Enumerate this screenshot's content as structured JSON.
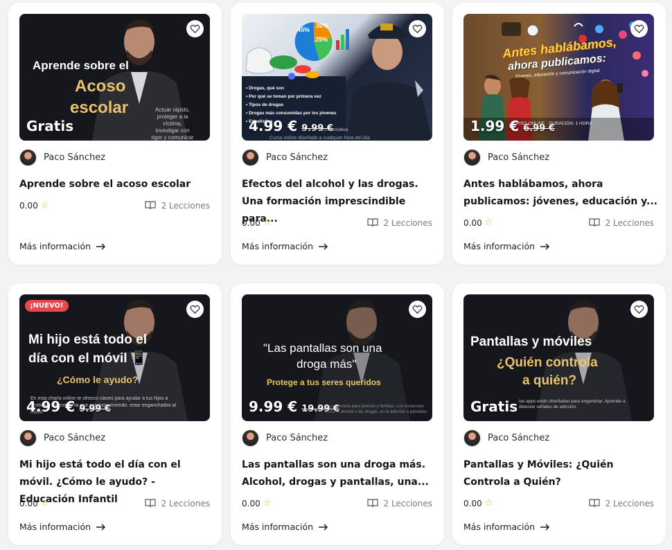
{
  "courses": [
    {
      "title": "Aprende sobre el acoso escolar",
      "author": "Paco Sánchez",
      "rating": "0.00",
      "lessons": "2 Lecciones",
      "more": "Más información",
      "price": "Gratis",
      "old_price": "",
      "badge": "",
      "thumb": {
        "line1": "Aprende sobre el",
        "line2": "Acoso",
        "line3": "escolar",
        "small": "Actuar rápido, proteger a la víctima, investigar con rigor y comunicar con"
      }
    },
    {
      "title": "Efectos del alcohol y las drogas. Una formación imprescindible para...",
      "author": "Paco Sánchez",
      "rating": "0.00",
      "lessons": "2 Lecciones",
      "more": "Más información",
      "price": "4.99 €",
      "old_price": "9.99 €",
      "badge": "",
      "thumb": {
        "pie1": "45%",
        "pie2": "30%",
        "pie3": "25%",
        "bullet1": "• Drogas, qué son",
        "bullet2": "• Por qué se toman por primera vez",
        "bullet3": "• Tipos de drogas",
        "bullet4": "• Drogas más consumidas por los jóvenes",
        "bullet5": "• Estadística",
        "small1": "problemática",
        "small2": "Curso online diseñado a cualquier hora del día"
      }
    },
    {
      "title": "Antes hablábamos, ahora publicamos: jóvenes, educación y...",
      "author": "Paco Sánchez",
      "rating": "0.00",
      "lessons": "2 Lecciones",
      "more": "Más información",
      "price": "1.99 €",
      "old_price": "6.99 €",
      "badge": "",
      "thumb": {
        "line1": "Antes hablábamos,",
        "line2": "ahora publicamos:",
        "line3": "Jóvenes, educación y comunicación digital",
        "small": "CURSO ONLINE · DURACIÓN: 1 HORA"
      }
    },
    {
      "title": "Mi hijo está todo el día con el móvil. ¿Cómo le ayudo? - Educación Infantil",
      "author": "Paco Sánchez",
      "rating": "0.00",
      "lessons": "2 Lecciones",
      "more": "Más información",
      "price": "4.99 €",
      "old_price": "9.99 €",
      "badge": "¡NUEVO!",
      "thumb": {
        "line1": "Mi hijo está todo el",
        "line2": "día con el móvil 📱",
        "line3": "¿Cómo le ayudo?",
        "small": "En esta charla online te ofrezco claves para ayudar a tus hijos a gestionar un problema que estamos viviendo: estar enganchados al móvil."
      }
    },
    {
      "title": "Las pantallas son una droga más. Alcohol, drogas y pantallas, una...",
      "author": "Paco Sánchez",
      "rating": "0.00",
      "lessons": "2 Lecciones",
      "more": "Más información",
      "price": "9.99 €",
      "old_price": "19.99 €",
      "badge": "",
      "thumb": {
        "line1": "\"Las pantallas son una",
        "line2": "droga más\"",
        "line3": "Protege a tus seres queridos",
        "small": "al y necesaria para jóvenes y familias. Los sustancias como el alcohol o las drogas, en la adicción a pantallas."
      }
    },
    {
      "title": "Pantallas y Móviles: ¿Quién Controla a Quién?",
      "author": "Paco Sánchez",
      "rating": "0.00",
      "lessons": "2 Lecciones",
      "more": "Más información",
      "price": "Gratis",
      "old_price": "",
      "badge": "",
      "thumb": {
        "line1": "Pantallas y móviles",
        "line2": "¿Quién controla",
        "line3": "a quién?",
        "small": "las apps están diseñadas para enganchar. Aprende a detectar señales de adicción."
      }
    }
  ]
}
